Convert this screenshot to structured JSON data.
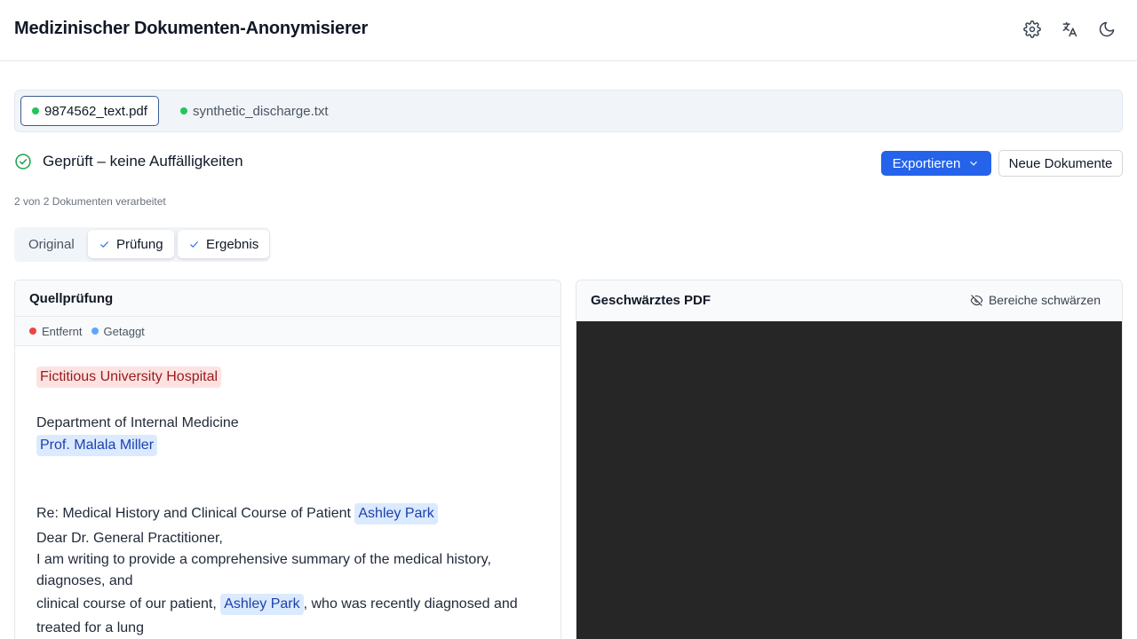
{
  "app": {
    "title": "Medizinischer Dokumenten-Anonymisierer"
  },
  "header_icons": [
    "gear-icon",
    "translate-icon",
    "moon-icon"
  ],
  "files": [
    {
      "name": "9874562_text.pdf",
      "status_color": "#22c55e",
      "active": true
    },
    {
      "name": "synthetic_discharge.txt",
      "status_color": "#22c55e",
      "active": false
    }
  ],
  "status": {
    "text": "Geprüft – keine Auffälligkeiten",
    "color": "#16a34a"
  },
  "actions": {
    "export_label": "Exportieren",
    "new_label": "Neue Dokumente"
  },
  "progress": {
    "text": "2 von 2 Dokumenten verarbeitet"
  },
  "view_tabs": [
    {
      "label": "Original",
      "done": false
    },
    {
      "label": "Prüfung",
      "done": true
    },
    {
      "label": "Ergebnis",
      "done": true
    }
  ],
  "source_panel": {
    "title": "Quellprüfung",
    "legend": [
      {
        "label": "Entfernt",
        "color": "#ef4444"
      },
      {
        "label": "Getaggt",
        "color": "#60a5fa"
      }
    ],
    "doc": {
      "hospital": "Fictitious University Hospital",
      "department": "Department of Internal Medicine",
      "doctor": "Prof. Malala Miller",
      "re_prefix": "Re: Medical History and Clinical Course of Patient ",
      "patient": "Ashley Park",
      "salutation": "Dear Dr. General Practitioner,",
      "body_line1": "I am writing to provide a comprehensive summary of the medical history,",
      "body_line2": "diagnoses, and",
      "body_line3_prefix": "clinical course of our patient, ",
      "body_line3_suffix": ", who was recently diagnosed and",
      "body_line4": "treated for a lung"
    }
  },
  "result_panel": {
    "title": "Geschwärztes PDF",
    "redact_label": "Bereiche schwärzen"
  },
  "colors": {
    "accent": "#2563eb",
    "removed_bg": "#fde2e2",
    "tagged_bg": "#dbeafe",
    "pdf_bg": "#262626"
  }
}
